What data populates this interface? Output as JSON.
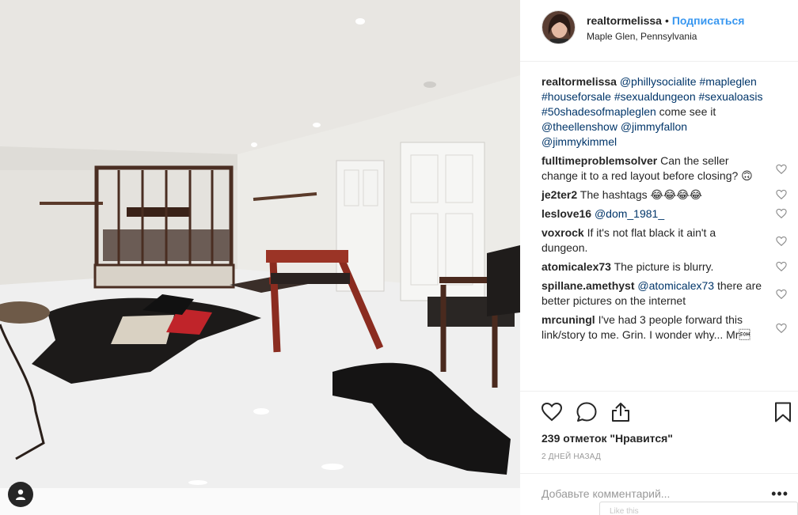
{
  "post": {
    "username": "realtormelissa",
    "separator": "•",
    "follow_label": "Подписаться",
    "location": "Maple Glen, Pennsylvania"
  },
  "caption": {
    "author": "realtormelissa",
    "parts": [
      {
        "text": "@phillysocialite",
        "link": true
      },
      {
        "text": " ",
        "link": false
      },
      {
        "text": "#mapleglen",
        "link": true
      },
      {
        "text": " ",
        "link": false
      },
      {
        "text": "#houseforsale",
        "link": true
      },
      {
        "text": " ",
        "link": false
      },
      {
        "text": "#sexualdungeon",
        "link": true
      },
      {
        "text": " ",
        "link": false
      },
      {
        "text": "#sexualoasis",
        "link": true
      },
      {
        "text": " ",
        "link": false
      },
      {
        "text": "#50shadesofmapleglen",
        "link": true
      },
      {
        "text": " come see it ",
        "link": false
      },
      {
        "text": "@theellenshow",
        "link": true
      },
      {
        "text": " ",
        "link": false
      },
      {
        "text": "@jimmyfallon",
        "link": true
      },
      {
        "text": " ",
        "link": false
      },
      {
        "text": "@jimmykimmel",
        "link": true
      }
    ]
  },
  "comments": [
    {
      "author": "fulltimeproblemsolver",
      "mention": "",
      "text": "Can the seller change it to a red layout before closing? 🙃",
      "lines": 3
    },
    {
      "author": "je2ter2",
      "mention": "",
      "text": "The hashtags 😂😂😂😂",
      "lines": 1
    },
    {
      "author": "leslove16",
      "mention": "@dom_1981_",
      "text": "",
      "lines": 1
    },
    {
      "author": "voxrock",
      "mention": "",
      "text": "If it's not flat black it ain't a dungeon.",
      "lines": 2
    },
    {
      "author": "atomicalex73",
      "mention": "",
      "text": "The picture is blurry.",
      "lines": 1
    },
    {
      "author": "spillane.amethyst",
      "mention": "@atomicalex73",
      "text": "there are better pictures on the internet",
      "lines": 3
    },
    {
      "author": "mrcuningl",
      "mention": "",
      "text": "I've had 3 people forward this link/story to me. Grin. I wonder why... Mr\u0001",
      "lines": 3
    }
  ],
  "icons": {
    "like": "heart-icon",
    "comment": "comment-icon",
    "share": "share-icon",
    "save": "bookmark-icon",
    "options": "more-options-icon",
    "user": "user-icon"
  },
  "likes_text": "239 отметок \"Нравится\"",
  "time_ago": "2 дней назад",
  "add_comment": {
    "placeholder": "Добавьте комментарий...",
    "more": "•••",
    "popup_hint": "Like this"
  },
  "colors": {
    "link": "#003569",
    "follow": "#3897f0",
    "muted": "#999999"
  }
}
